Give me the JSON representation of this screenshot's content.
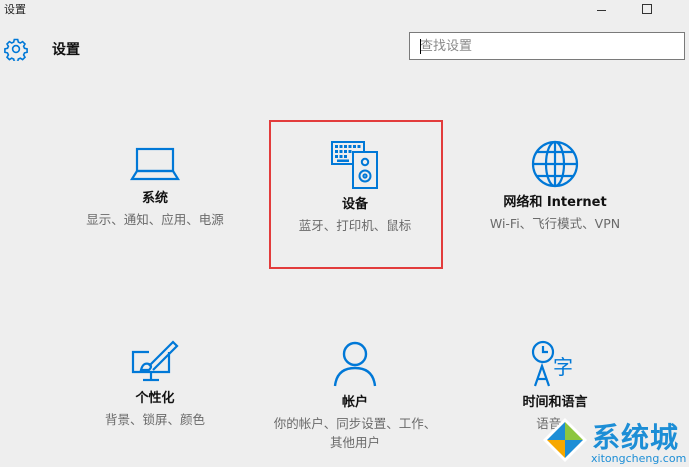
{
  "window": {
    "title": "设置"
  },
  "header": {
    "title": "设置",
    "icon": "gear-icon"
  },
  "search": {
    "placeholder": "查找设置",
    "value": ""
  },
  "accent_color": "#0078d7",
  "highlight_color": "#e23b3b",
  "categories": [
    {
      "name": "系统",
      "description": "显示、通知、应用、电源",
      "icon": "laptop-icon"
    },
    {
      "name": "设备",
      "description": "蓝牙、打印机、鼠标",
      "icon": "keyboard-speaker-icon",
      "highlighted": true
    },
    {
      "name": "网络和 Internet",
      "description": "Wi-Fi、飞行模式、VPN",
      "icon": "globe-icon"
    },
    {
      "name": "个性化",
      "description": "背景、锁屏、颜色",
      "icon": "paintbrush-monitor-icon"
    },
    {
      "name": "帐户",
      "description": "你的帐户、同步设置、工作、其他用户",
      "icon": "person-icon"
    },
    {
      "name": "时间和语言",
      "description": "语音、",
      "icon": "time-language-icon"
    }
  ],
  "watermark": {
    "text": "系统城",
    "url": "xitongcheng.com"
  }
}
